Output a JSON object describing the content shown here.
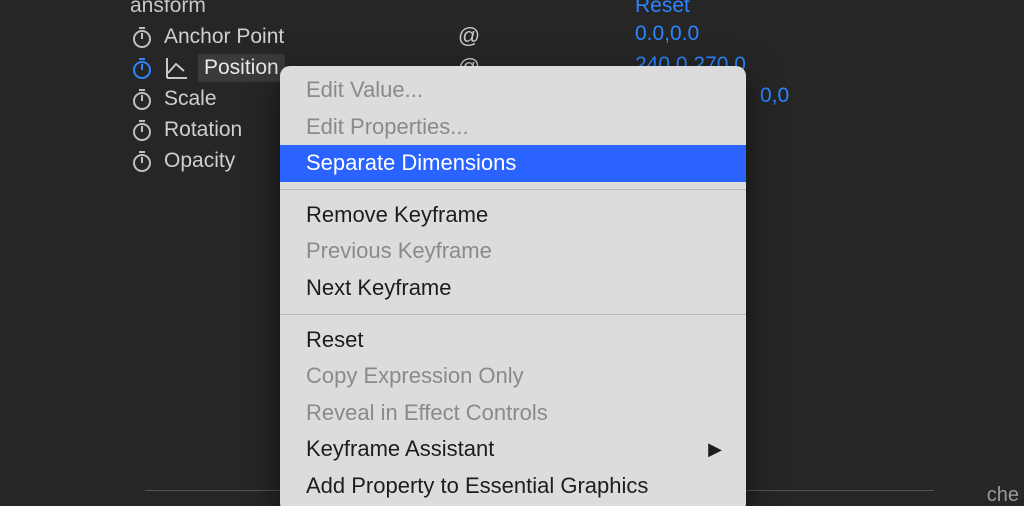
{
  "header": {
    "section_label": "ansform",
    "reset_label": "Reset"
  },
  "properties": [
    {
      "label": "Anchor Point",
      "value": "0.0,0.0",
      "active": false,
      "selected": false,
      "has_graph": false
    },
    {
      "label": "Position",
      "value": "240.0,270.0",
      "active": true,
      "selected": true,
      "has_graph": true
    },
    {
      "label": "Scale",
      "value": "0,0",
      "active": false,
      "selected": false,
      "has_graph": false
    },
    {
      "label": "Rotation",
      "value": "",
      "active": false,
      "selected": false,
      "has_graph": false
    },
    {
      "label": "Opacity",
      "value": "",
      "active": false,
      "selected": false,
      "has_graph": false
    }
  ],
  "footer_fragment": "che",
  "menu": {
    "items": [
      {
        "label": "Edit Value...",
        "disabled": true
      },
      {
        "label": "Edit Properties...",
        "disabled": true
      },
      {
        "label": "Separate Dimensions",
        "highlight": true
      },
      {
        "sep": true
      },
      {
        "label": "Remove Keyframe"
      },
      {
        "label": "Previous Keyframe",
        "disabled": true
      },
      {
        "label": "Next Keyframe"
      },
      {
        "sep": true
      },
      {
        "label": "Reset"
      },
      {
        "label": "Copy Expression Only",
        "disabled": true
      },
      {
        "label": "Reveal in Effect Controls",
        "disabled": true
      },
      {
        "label": "Keyframe Assistant",
        "submenu": true
      },
      {
        "label": "Add Property to Essential Graphics"
      }
    ]
  }
}
